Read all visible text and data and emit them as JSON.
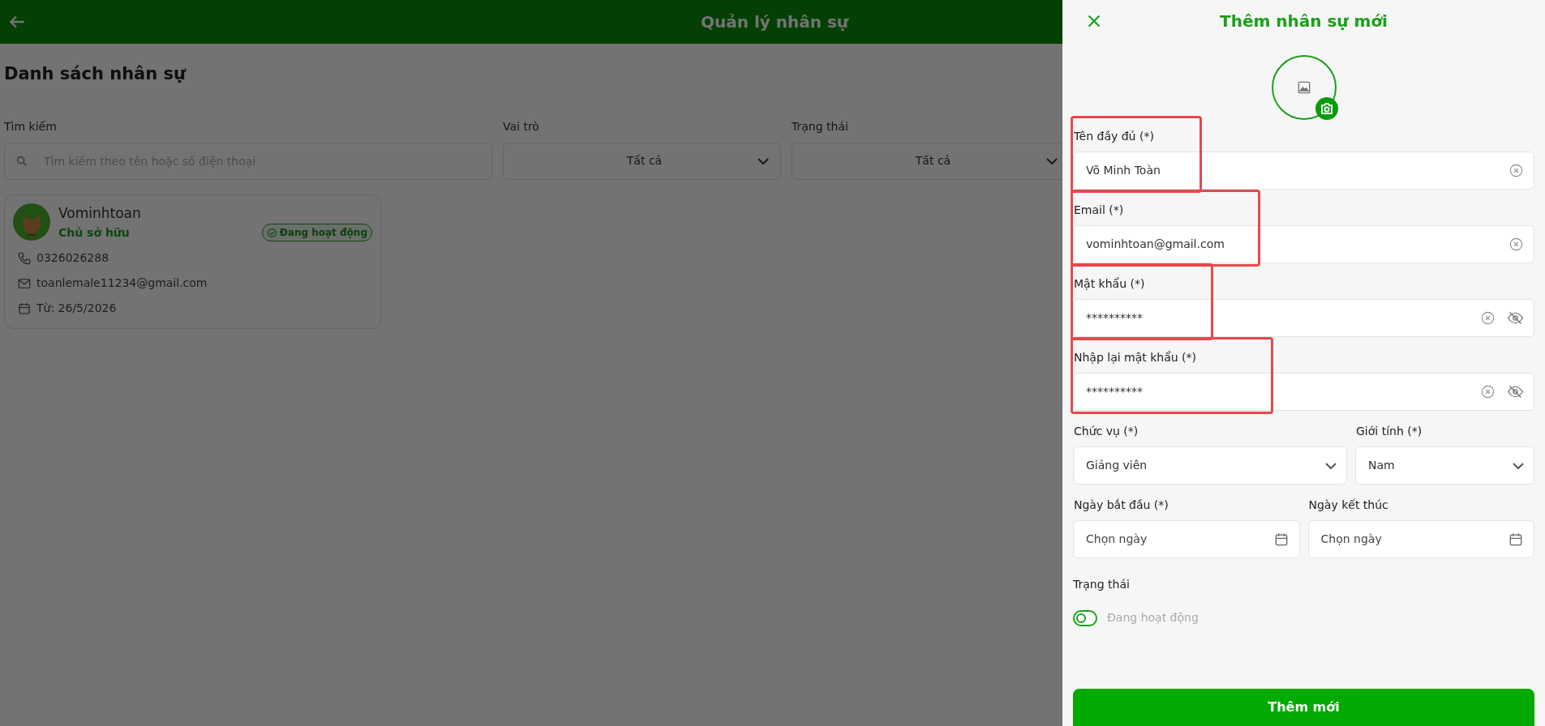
{
  "header": {
    "title": "Quản lý nhân sự"
  },
  "page": {
    "title": "Danh sách nhân sự",
    "filters": [
      {
        "kind": "search",
        "label": "Tìm kiếm",
        "placeholder": "Tìm kiếm theo tên hoặc số điện thoại"
      },
      {
        "kind": "select",
        "label": "Vai trò",
        "value": "Tất cả"
      },
      {
        "kind": "select",
        "label": "Trạng thái",
        "value": "Tất cả"
      }
    ],
    "staff": [
      {
        "name": "Vominhtoan",
        "role": "Chủ sở hữu",
        "status": "Đang hoạt động",
        "phone": "0326026288",
        "email": "toanlemale11234@gmail.com",
        "since": "Từ: 26/5/2026"
      }
    ]
  },
  "dialog": {
    "title": "Thêm nhân sự mới",
    "rows": [
      {
        "fields": [
          {
            "kind": "text",
            "label": "Tên đầy đủ (*)",
            "value": "Võ Minh Toàn",
            "highlighted": true
          }
        ]
      },
      {
        "fields": [
          {
            "kind": "text",
            "label": "Email (*)",
            "value": "vominhtoan@gmail.com",
            "highlighted": true
          }
        ]
      },
      {
        "fields": [
          {
            "kind": "password",
            "label": "Mật khẩu (*)",
            "value": "**********",
            "highlighted": true
          }
        ]
      },
      {
        "fields": [
          {
            "kind": "password",
            "label": "Nhập lại mật khẩu (*)",
            "value": "**********",
            "highlighted": true
          }
        ]
      },
      {
        "fields": [
          {
            "kind": "select",
            "label": "Chức vụ (*)",
            "value": "Giảng viên",
            "highlighted": false
          },
          {
            "kind": "select",
            "label": "Giới tính (*)",
            "value": "Nam",
            "highlighted": false
          }
        ]
      },
      {
        "fields": [
          {
            "kind": "date",
            "label": "Ngày bắt đầu (*)",
            "placeholder": "Chọn ngày",
            "highlighted": false
          },
          {
            "kind": "date",
            "label": "Ngày kết thúc",
            "placeholder": "Chọn ngày",
            "highlighted": false
          }
        ]
      }
    ],
    "status": {
      "label": "Trạng thái",
      "toggle_label": "Đang hoạt động",
      "on": false
    },
    "submit": "Thêm mới"
  }
}
